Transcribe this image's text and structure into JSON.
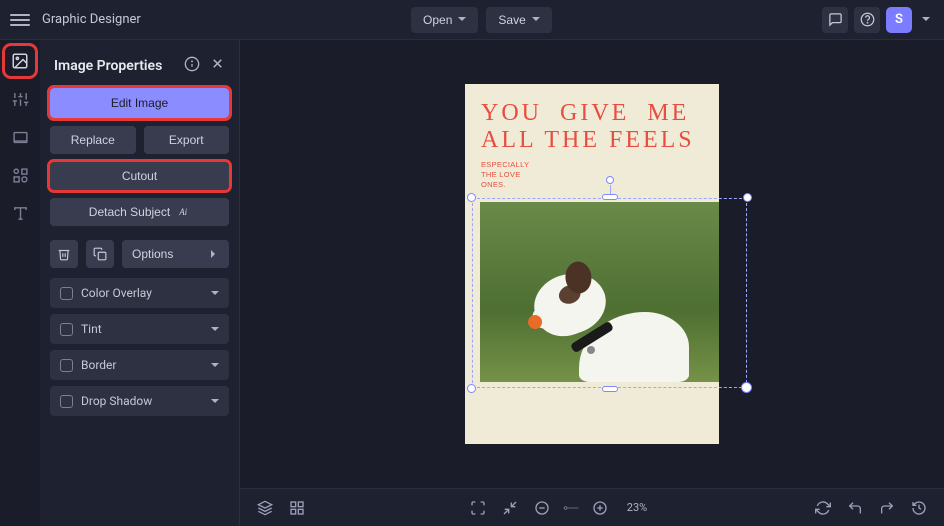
{
  "topbar": {
    "title": "Graphic Designer",
    "open_label": "Open",
    "save_label": "Save",
    "avatar_initial": "S"
  },
  "panel": {
    "title": "Image Properties",
    "edit_image": "Edit Image",
    "replace": "Replace",
    "export": "Export",
    "cutout": "Cutout",
    "detach_subject": "Detach Subject",
    "ai_badge": "Ai",
    "options": "Options",
    "collapsibles": [
      {
        "label": "Color Overlay"
      },
      {
        "label": "Tint"
      },
      {
        "label": "Border"
      },
      {
        "label": "Drop Shadow"
      }
    ]
  },
  "canvas": {
    "headline": "YOU  GIVE  ME\nALL THE FEELS",
    "subline": "ESPECIALLY\nTHE LOVE\nONES."
  },
  "bottombar": {
    "zoom": "23%"
  }
}
